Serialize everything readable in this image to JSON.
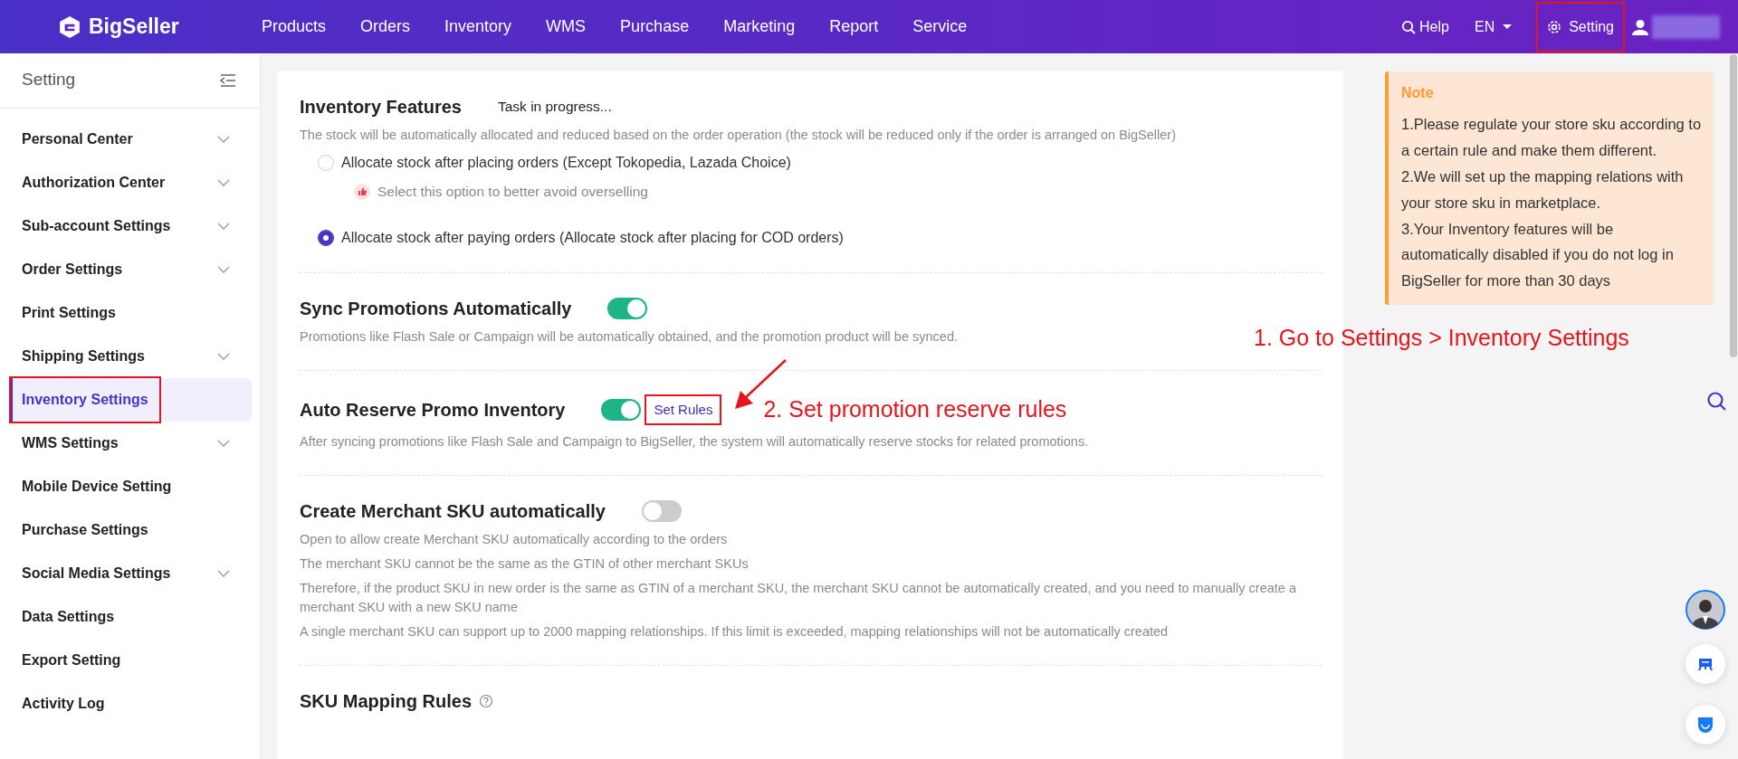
{
  "topbar": {
    "logo": "BigSeller",
    "nav": [
      {
        "label": "Products"
      },
      {
        "label": "Orders"
      },
      {
        "label": "Inventory"
      },
      {
        "label": "WMS"
      },
      {
        "label": "Purchase"
      },
      {
        "label": "Marketing"
      },
      {
        "label": "Report"
      },
      {
        "label": "Service"
      }
    ],
    "help": "Help",
    "language": "EN",
    "setting": {
      "label": "Setting",
      "highlighted": true
    }
  },
  "sidebar": {
    "title": "Setting",
    "items": [
      {
        "label": "Personal Center",
        "expandable": true,
        "selected": false,
        "highlighted": false
      },
      {
        "label": "Authorization Center",
        "expandable": true,
        "selected": false,
        "highlighted": false
      },
      {
        "label": "Sub-account Settings",
        "expandable": true,
        "selected": false,
        "highlighted": false
      },
      {
        "label": "Order Settings",
        "expandable": true,
        "selected": false,
        "highlighted": false
      },
      {
        "label": "Print Settings",
        "expandable": false,
        "selected": false,
        "highlighted": false
      },
      {
        "label": "Shipping Settings",
        "expandable": true,
        "selected": false,
        "highlighted": false
      },
      {
        "label": "Inventory Settings",
        "expandable": false,
        "selected": true,
        "highlighted": true
      },
      {
        "label": "WMS Settings",
        "expandable": true,
        "selected": false,
        "highlighted": false
      },
      {
        "label": "Mobile Device Setting",
        "expandable": false,
        "selected": false,
        "highlighted": false
      },
      {
        "label": "Purchase Settings",
        "expandable": false,
        "selected": false,
        "highlighted": false
      },
      {
        "label": "Social Media Settings",
        "expandable": true,
        "selected": false,
        "highlighted": false
      },
      {
        "label": "Data Settings",
        "expandable": false,
        "selected": false,
        "highlighted": false
      },
      {
        "label": "Export Setting",
        "expandable": false,
        "selected": false,
        "highlighted": false
      },
      {
        "label": "Activity Log",
        "expandable": false,
        "selected": false,
        "highlighted": false
      }
    ]
  },
  "sections": [
    {
      "kind": "radio",
      "title": "Inventory Features",
      "status": "Task in progress...",
      "description": [
        "The stock will be automatically allocated and reduced based on the order operation (the stock will be reduced only if the order is arranged on BigSeller)"
      ],
      "options": [
        {
          "label": "Allocate stock after placing orders (Except Tokopedia, Lazada Choice)",
          "selected": false,
          "hint": "Select this option to better avoid overselling"
        },
        {
          "label": "Allocate stock after paying orders (Allocate stock after placing for COD orders)",
          "selected": true
        }
      ]
    },
    {
      "kind": "toggle",
      "title": "Sync Promotions Automatically",
      "on": true,
      "description": [
        "Promotions like Flash Sale or Campaign will be automatically obtained, and the promotion product will be synced."
      ]
    },
    {
      "kind": "toggle",
      "title": "Auto Reserve Promo Inventory",
      "on": true,
      "link": {
        "label": "Set Rules",
        "highlighted": true
      },
      "annotation": "2. Set promotion reserve rules",
      "description": [
        "After syncing promotions like Flash Sale and Campaign to BigSeller, the system will automatically reserve stocks for related promotions."
      ]
    },
    {
      "kind": "toggle",
      "title": "Create Merchant SKU automatically",
      "on": false,
      "description": [
        "Open to allow create Merchant SKU automatically according to the orders",
        "The merchant SKU cannot be the same as the GTIN of other merchant SKUs",
        "Therefore, if the product SKU in new order is the same as GTIN of a merchant SKU, the merchant SKU cannot be automatically created, and you need to manually create a merchant SKU with a new SKU name",
        "A single merchant SKU can support up to 2000 mapping relationships. If this limit is exceeded, mapping relationships will not be automatically created"
      ]
    },
    {
      "kind": "heading",
      "title": "SKU Mapping Rules"
    }
  ],
  "note": {
    "title": "Note",
    "lines": [
      "1.Please regulate your store sku according to a certain rule and make them different.",
      "2.We will set up the mapping relations with your store sku in marketplace.",
      "3.Your Inventory features will be automatically disabled if you do not log in BigSeller for more than 30 days"
    ]
  },
  "annotation": "1. Go to Settings > Inventory Settings"
}
